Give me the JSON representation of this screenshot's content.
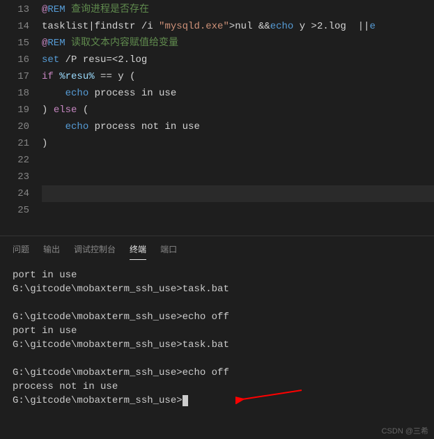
{
  "editor": {
    "lines": [
      {
        "num": "13",
        "segments": [
          {
            "t": "@",
            "c": "kw-at"
          },
          {
            "t": "REM",
            "c": "kw-rem"
          },
          {
            "t": " 查询进程是否存在",
            "c": "comment"
          }
        ]
      },
      {
        "num": "14",
        "segments": [
          {
            "t": "tasklist",
            "c": "plain"
          },
          {
            "t": "|",
            "c": "op"
          },
          {
            "t": "findstr /i ",
            "c": "plain"
          },
          {
            "t": "\"mysqld.exe\"",
            "c": "str"
          },
          {
            "t": ">",
            "c": "op"
          },
          {
            "t": "nul ",
            "c": "plain"
          },
          {
            "t": "&&",
            "c": "op"
          },
          {
            "t": "echo",
            "c": "kw-cmd"
          },
          {
            "t": " y ",
            "c": "plain"
          },
          {
            "t": ">",
            "c": "op"
          },
          {
            "t": "2.log  ",
            "c": "plain"
          },
          {
            "t": "||",
            "c": "op"
          },
          {
            "t": "e",
            "c": "kw-cmd"
          }
        ]
      },
      {
        "num": "15",
        "segments": [
          {
            "t": "@",
            "c": "kw-at"
          },
          {
            "t": "REM",
            "c": "kw-rem"
          },
          {
            "t": " 读取文本内容赋值给变量",
            "c": "comment"
          }
        ]
      },
      {
        "num": "16",
        "segments": [
          {
            "t": "set",
            "c": "kw-cmd"
          },
          {
            "t": " /P resu",
            "c": "plain"
          },
          {
            "t": "=<",
            "c": "op"
          },
          {
            "t": "2.log",
            "c": "plain"
          }
        ]
      },
      {
        "num": "17",
        "segments": [
          {
            "t": "if",
            "c": "kw-flow"
          },
          {
            "t": " ",
            "c": "plain"
          },
          {
            "t": "%resu%",
            "c": "var"
          },
          {
            "t": " ",
            "c": "plain"
          },
          {
            "t": "==",
            "c": "op"
          },
          {
            "t": " y ",
            "c": "plain"
          },
          {
            "t": "(",
            "c": "op"
          }
        ]
      },
      {
        "num": "18",
        "segments": [
          {
            "t": "    ",
            "c": "plain"
          },
          {
            "t": "echo",
            "c": "kw-cmd"
          },
          {
            "t": " process in use",
            "c": "plain"
          }
        ]
      },
      {
        "num": "19",
        "segments": [
          {
            "t": ")",
            "c": "op"
          },
          {
            "t": " ",
            "c": "plain"
          },
          {
            "t": "else",
            "c": "kw-flow"
          },
          {
            "t": " ",
            "c": "plain"
          },
          {
            "t": "(",
            "c": "op"
          }
        ]
      },
      {
        "num": "20",
        "segments": [
          {
            "t": "    ",
            "c": "plain"
          },
          {
            "t": "echo",
            "c": "kw-cmd"
          },
          {
            "t": " process not in use",
            "c": "plain"
          }
        ]
      },
      {
        "num": "21",
        "segments": [
          {
            "t": ")",
            "c": "op"
          }
        ]
      },
      {
        "num": "22",
        "segments": []
      },
      {
        "num": "23",
        "segments": []
      },
      {
        "num": "24",
        "segments": [],
        "current": true
      },
      {
        "num": "25",
        "segments": []
      }
    ]
  },
  "tabs": {
    "items": [
      "问题",
      "输出",
      "调试控制台",
      "终端",
      "端口"
    ],
    "active": 3
  },
  "terminal": {
    "lines": [
      "port in use",
      "G:\\gitcode\\mobaxterm_ssh_use>task.bat",
      "",
      "G:\\gitcode\\mobaxterm_ssh_use>echo off",
      "port in use",
      "G:\\gitcode\\mobaxterm_ssh_use>task.bat",
      "",
      "G:\\gitcode\\mobaxterm_ssh_use>echo off",
      "process not in use",
      "G:\\gitcode\\mobaxterm_ssh_use>"
    ],
    "cursor_line": 9
  },
  "watermark": "CSDN @三希"
}
